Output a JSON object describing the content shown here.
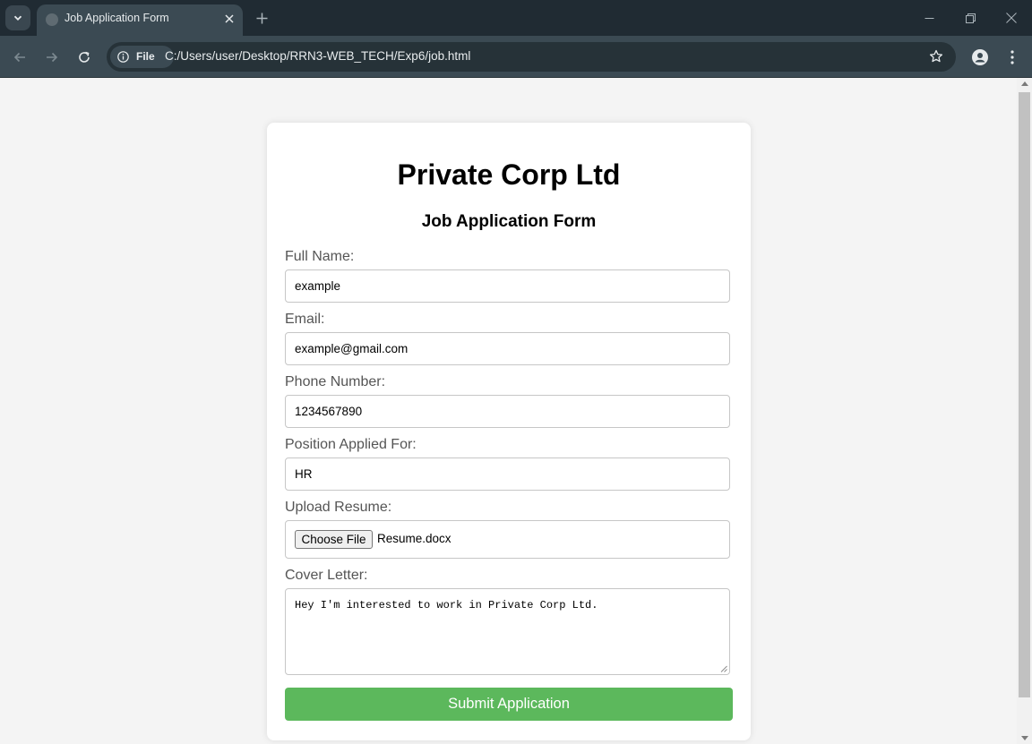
{
  "browser": {
    "tab": {
      "title": "Job Application Form"
    },
    "site_chip": "File",
    "url": "C:/Users/user/Desktop/RRN3-WEB_TECH/Exp6/job.html",
    "icons": [
      "tab-search-icon",
      "globe-icon",
      "close-icon",
      "plus-icon",
      "minimize-icon",
      "restore-icon",
      "window-close-icon",
      "back-arrow-icon",
      "forward-arrow-icon",
      "reload-icon",
      "info-icon",
      "star-icon",
      "profile-icon",
      "more-vert-icon"
    ]
  },
  "page": {
    "company": "Private Corp Ltd",
    "form_title": "Job Application Form",
    "fields": {
      "full_name": {
        "label": "Full Name:",
        "value": "example"
      },
      "email": {
        "label": "Email:",
        "value": "example@gmail.com"
      },
      "phone": {
        "label": "Phone Number:",
        "value": "1234567890"
      },
      "position": {
        "label": "Position Applied For:",
        "value": "HR"
      },
      "resume": {
        "label": "Upload Resume:",
        "button": "Choose File",
        "file_name": "Resume.docx"
      },
      "cover_letter": {
        "label": "Cover Letter:",
        "value": "Hey I'm interested to work in Private Corp Ltd."
      }
    },
    "submit_label": "Submit Application",
    "colors": {
      "submit": "#5cb85c",
      "titlebar": "#202b33",
      "toolbar": "#3b4a53"
    }
  }
}
